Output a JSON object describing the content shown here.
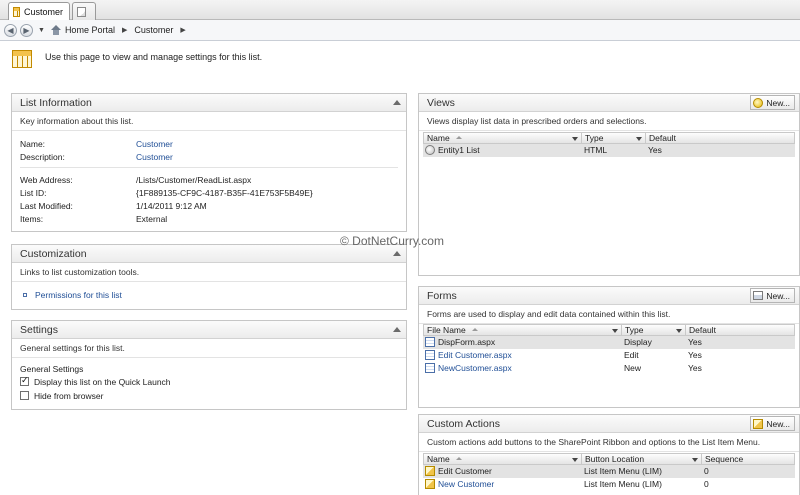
{
  "tabs": [
    {
      "label": "Customer",
      "icon": "list-grid-icon"
    },
    {
      "label": "",
      "icon": "new-tab-icon"
    }
  ],
  "breadcrumb": [
    "Home Portal",
    "Customer"
  ],
  "intro": "Use this page to view and manage settings for this list.",
  "watermark": "© DotNetCurry.com",
  "list_information": {
    "title": "List Information",
    "description": "Key information about this list.",
    "name_label": "Name:",
    "name_value": "Customer",
    "desc_label": "Description:",
    "desc_value": "Customer",
    "web_label": "Web Address:",
    "web_value": "/Lists/Customer/ReadList.aspx",
    "id_label": "List ID:",
    "id_value": "{1F889135-CF9C-4187-B35F-41E753F5B49E}",
    "modified_label": "Last Modified:",
    "modified_value": "1/14/2011 9:12 AM",
    "items_label": "Items:",
    "items_value": "External"
  },
  "customization": {
    "title": "Customization",
    "description": "Links to list customization tools.",
    "link": "Permissions for this list"
  },
  "settings": {
    "title": "Settings",
    "description": "General settings for this list.",
    "group_title": "General Settings",
    "option1": "Display this list on the Quick Launch",
    "option2": "Hide from browser"
  },
  "views": {
    "title": "Views",
    "new_label": "New...",
    "description": "Views display list data in prescribed orders and selections.",
    "headers": [
      "Name",
      "Type",
      "Default"
    ],
    "rows": [
      {
        "name": "Entity1 List",
        "type": "HTML",
        "default": "Yes"
      }
    ]
  },
  "forms": {
    "title": "Forms",
    "new_label": "New...",
    "description": "Forms are used to display and edit data contained within this list.",
    "headers": [
      "File Name",
      "Type",
      "Default"
    ],
    "rows": [
      {
        "name": "DispForm.aspx",
        "type": "Display",
        "default": "Yes"
      },
      {
        "name": "Edit Customer.aspx",
        "type": "Edit",
        "default": "Yes"
      },
      {
        "name": "NewCustomer.aspx",
        "type": "New",
        "default": "Yes"
      }
    ]
  },
  "custom_actions": {
    "title": "Custom Actions",
    "new_label": "New...",
    "description": "Custom actions add buttons to the SharePoint Ribbon and options to the List Item Menu.",
    "headers": [
      "Name",
      "Button Location",
      "Sequence"
    ],
    "rows": [
      {
        "name": "Edit Customer",
        "location": "List Item Menu (LIM)",
        "sequence": "0"
      },
      {
        "name": "New Customer",
        "location": "List Item Menu (LIM)",
        "sequence": "0"
      }
    ]
  }
}
